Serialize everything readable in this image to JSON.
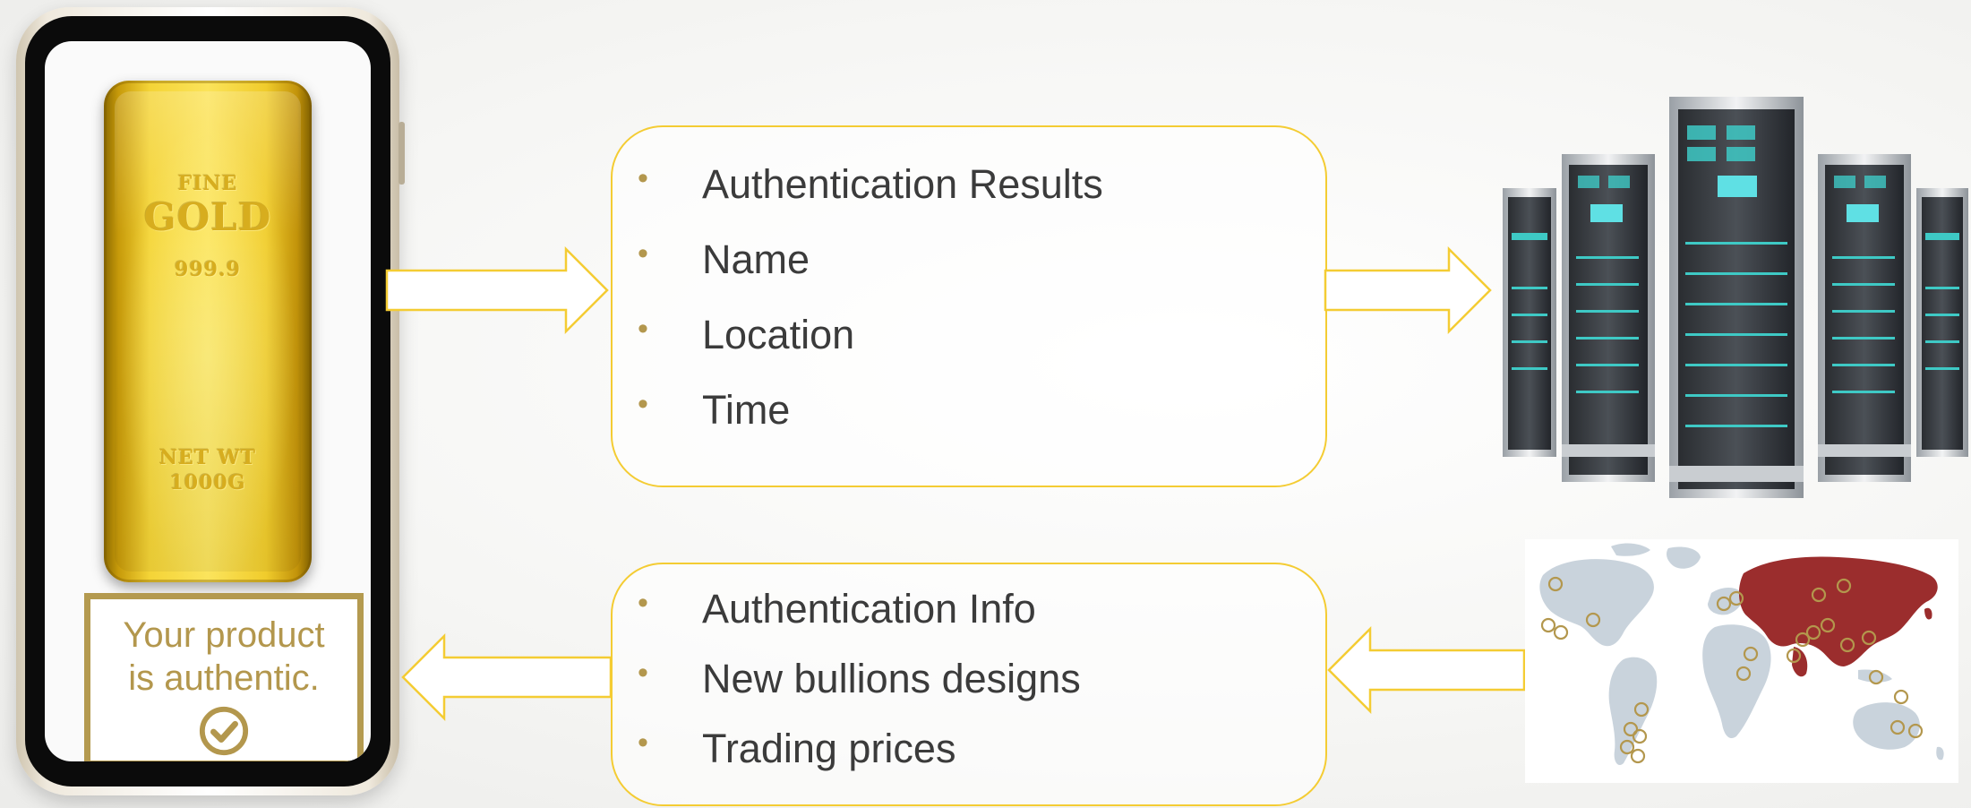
{
  "phone": {
    "gold_bar": {
      "line1": "FINE",
      "line2": "GOLD",
      "line3": "999.9",
      "line4": "NET WT",
      "line5": "1000G"
    },
    "auth_message": {
      "line1": "Your product",
      "line2": "is authentic."
    }
  },
  "upload_box": {
    "items": [
      "Authentication Results",
      "Name",
      "Location",
      "Time"
    ]
  },
  "download_box": {
    "items": [
      "Authentication Info",
      "New bullions designs",
      "Trading prices"
    ]
  },
  "colors": {
    "accent_gold": "#b3974d",
    "arrow_yellow": "#f4cc33",
    "asia_red": "#9b2d2d",
    "map_gray": "#c9d3dc",
    "server_teal": "#3ec9c5"
  },
  "icons": {
    "check": "check-circle-icon",
    "servers": "server-rack-icon",
    "map": "world-map-icon"
  }
}
